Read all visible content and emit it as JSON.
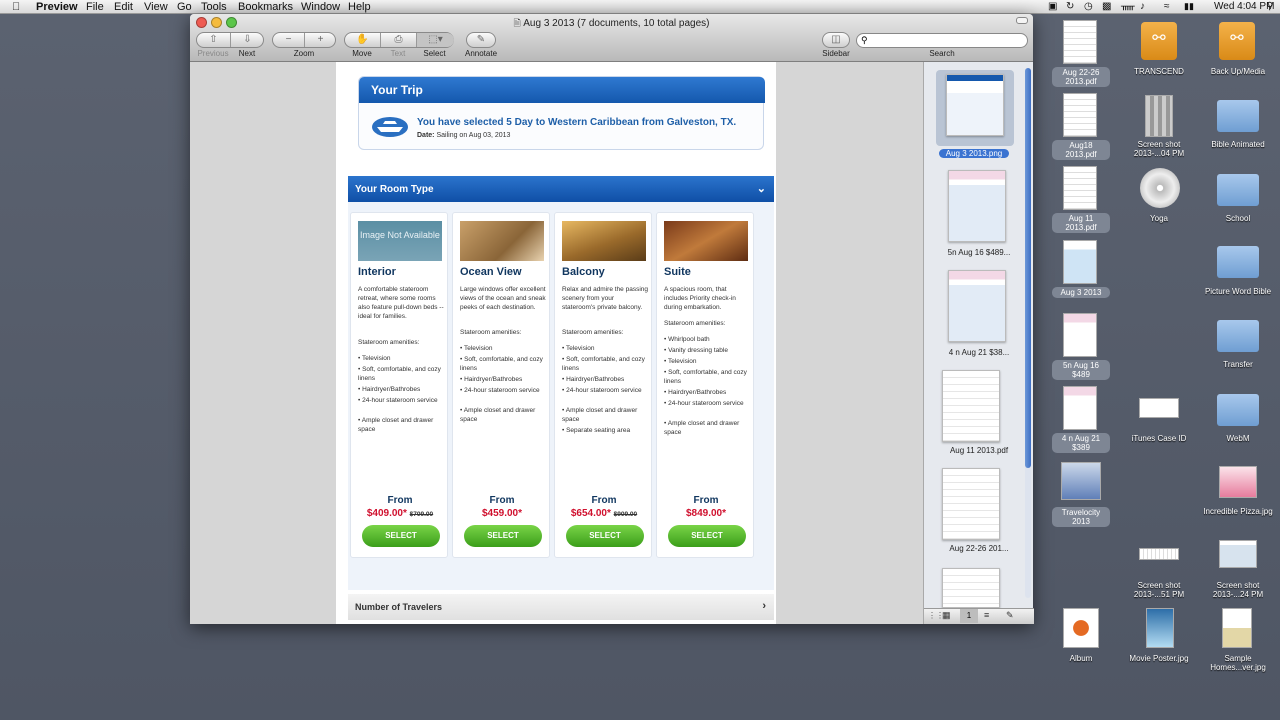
{
  "menubar": {
    "apple": "",
    "app": "Preview",
    "items": [
      "File",
      "Edit",
      "View",
      "Go",
      "Tools",
      "Bookmarks",
      "Window",
      "Help"
    ],
    "clock": "Wed 4:04 PM"
  },
  "window": {
    "title": "Aug 3 2013 (7 documents, 10 total pages)",
    "toolbar": {
      "previous": "Previous",
      "next": "Next",
      "zoom": "Zoom",
      "move": "Move",
      "text": "Text",
      "select": "Select",
      "annotate": "Annotate",
      "sidebar": "Sidebar",
      "search": "Search"
    }
  },
  "trip": {
    "header": "Your Trip",
    "main": "You have selected 5 Day to Western Caribbean from Galveston, TX.",
    "date_label": "Date:",
    "date_value": "Sailing on Aug 03, 2013"
  },
  "room_type": {
    "header": "Your Room Type",
    "cards": [
      {
        "name": "Interior",
        "image_text": "Image Not Available",
        "desc": "A comfortable stateroom retreat, where some rooms also feature pull-down beds -- ideal for families.",
        "amenities_label": "Stateroom amenities:",
        "amenities": [
          "Television",
          "Soft, comfortable, and cozy linens",
          "Hairdryer/Bathrobes",
          "24-hour stateroom service",
          "Ample closet and drawer space"
        ],
        "from": "From",
        "price": "$409.00*",
        "old_price": "$709.00",
        "select": "SELECT"
      },
      {
        "name": "Ocean View",
        "desc": "Large windows offer excellent views of the ocean and sneak peeks of each destination.",
        "amenities_label": "Stateroom amenities:",
        "amenities": [
          "Television",
          "Soft, comfortable, and cozy linens",
          "Hairdryer/Bathrobes",
          "24-hour stateroom service",
          "Ample closet and drawer space"
        ],
        "from": "From",
        "price": "$459.00*",
        "old_price": "",
        "select": "SELECT"
      },
      {
        "name": "Balcony",
        "desc": "Relax and admire the passing scenery from your stateroom's private balcony.",
        "amenities_label": "Stateroom amenities:",
        "amenities": [
          "Television",
          "Soft, comfortable, and cozy linens",
          "Hairdryer/Bathrobes",
          "24-hour stateroom service",
          "Ample closet and drawer space",
          "Separate seating area"
        ],
        "from": "From",
        "price": "$654.00*",
        "old_price": "$909.00",
        "select": "SELECT"
      },
      {
        "name": "Suite",
        "desc": "A spacious room, that includes Priority check-in during embarkation.",
        "amenities_label": "Stateroom amenities:",
        "amenities": [
          "Whirlpool bath",
          "Vanity dressing table",
          "Television",
          "Soft, comfortable, and cozy linens",
          "Hairdryer/Bathrobes",
          "24-hour stateroom service",
          "Ample closet and drawer space"
        ],
        "from": "From",
        "price": "$849.00*",
        "old_price": "",
        "select": "SELECT"
      }
    ]
  },
  "travelers": {
    "header": "Number of Travelers"
  },
  "sidebar": {
    "thumbs": [
      "Aug 3 2013.png",
      "5n Aug 16 $489...",
      "4 n Aug 21 $38...",
      "Aug 11 2013.pdf",
      "Aug 22-26 201..."
    ],
    "page_num": "1"
  },
  "desktop": {
    "col1": [
      "Aug 22-26 2013.pdf",
      "Aug18 2013.pdf",
      "Aug 11 2013.pdf",
      "Aug 3 2013",
      "5n Aug 16 $489",
      "4 n Aug 21 $389",
      "Travelocity 2013",
      "Album"
    ],
    "col2": [
      "TRANSCEND",
      "Screen shot 2013-...04 PM",
      "Yoga",
      "iTunes Case ID",
      "Screen shot 2013-...51 PM",
      "Movie Poster.jpg"
    ],
    "col3": [
      "Back Up/Media",
      "Bible Animated",
      "School",
      "Picture Word Bible",
      "Transfer",
      "WebM",
      "Incredible Pizza.jpg",
      "Screen shot 2013-...24 PM",
      "Sample Homes...ver.jpg"
    ]
  },
  "colors": {
    "desktop": "#565d6b",
    "header_blue": "#1458ad",
    "price_red": "#d0102e",
    "select_green": "#3b9e1a"
  }
}
